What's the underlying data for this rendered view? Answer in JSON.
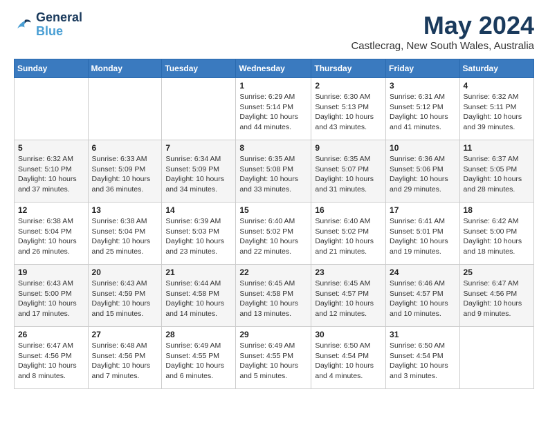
{
  "logo": {
    "line1": "General",
    "line2": "Blue"
  },
  "title": "May 2024",
  "subtitle": "Castlecrag, New South Wales, Australia",
  "days_header": [
    "Sunday",
    "Monday",
    "Tuesday",
    "Wednesday",
    "Thursday",
    "Friday",
    "Saturday"
  ],
  "weeks": [
    [
      {
        "day": "",
        "detail": ""
      },
      {
        "day": "",
        "detail": ""
      },
      {
        "day": "",
        "detail": ""
      },
      {
        "day": "1",
        "detail": "Sunrise: 6:29 AM\nSunset: 5:14 PM\nDaylight: 10 hours\nand 44 minutes."
      },
      {
        "day": "2",
        "detail": "Sunrise: 6:30 AM\nSunset: 5:13 PM\nDaylight: 10 hours\nand 43 minutes."
      },
      {
        "day": "3",
        "detail": "Sunrise: 6:31 AM\nSunset: 5:12 PM\nDaylight: 10 hours\nand 41 minutes."
      },
      {
        "day": "4",
        "detail": "Sunrise: 6:32 AM\nSunset: 5:11 PM\nDaylight: 10 hours\nand 39 minutes."
      }
    ],
    [
      {
        "day": "5",
        "detail": "Sunrise: 6:32 AM\nSunset: 5:10 PM\nDaylight: 10 hours\nand 37 minutes."
      },
      {
        "day": "6",
        "detail": "Sunrise: 6:33 AM\nSunset: 5:09 PM\nDaylight: 10 hours\nand 36 minutes."
      },
      {
        "day": "7",
        "detail": "Sunrise: 6:34 AM\nSunset: 5:09 PM\nDaylight: 10 hours\nand 34 minutes."
      },
      {
        "day": "8",
        "detail": "Sunrise: 6:35 AM\nSunset: 5:08 PM\nDaylight: 10 hours\nand 33 minutes."
      },
      {
        "day": "9",
        "detail": "Sunrise: 6:35 AM\nSunset: 5:07 PM\nDaylight: 10 hours\nand 31 minutes."
      },
      {
        "day": "10",
        "detail": "Sunrise: 6:36 AM\nSunset: 5:06 PM\nDaylight: 10 hours\nand 29 minutes."
      },
      {
        "day": "11",
        "detail": "Sunrise: 6:37 AM\nSunset: 5:05 PM\nDaylight: 10 hours\nand 28 minutes."
      }
    ],
    [
      {
        "day": "12",
        "detail": "Sunrise: 6:38 AM\nSunset: 5:04 PM\nDaylight: 10 hours\nand 26 minutes."
      },
      {
        "day": "13",
        "detail": "Sunrise: 6:38 AM\nSunset: 5:04 PM\nDaylight: 10 hours\nand 25 minutes."
      },
      {
        "day": "14",
        "detail": "Sunrise: 6:39 AM\nSunset: 5:03 PM\nDaylight: 10 hours\nand 23 minutes."
      },
      {
        "day": "15",
        "detail": "Sunrise: 6:40 AM\nSunset: 5:02 PM\nDaylight: 10 hours\nand 22 minutes."
      },
      {
        "day": "16",
        "detail": "Sunrise: 6:40 AM\nSunset: 5:02 PM\nDaylight: 10 hours\nand 21 minutes."
      },
      {
        "day": "17",
        "detail": "Sunrise: 6:41 AM\nSunset: 5:01 PM\nDaylight: 10 hours\nand 19 minutes."
      },
      {
        "day": "18",
        "detail": "Sunrise: 6:42 AM\nSunset: 5:00 PM\nDaylight: 10 hours\nand 18 minutes."
      }
    ],
    [
      {
        "day": "19",
        "detail": "Sunrise: 6:43 AM\nSunset: 5:00 PM\nDaylight: 10 hours\nand 17 minutes."
      },
      {
        "day": "20",
        "detail": "Sunrise: 6:43 AM\nSunset: 4:59 PM\nDaylight: 10 hours\nand 15 minutes."
      },
      {
        "day": "21",
        "detail": "Sunrise: 6:44 AM\nSunset: 4:58 PM\nDaylight: 10 hours\nand 14 minutes."
      },
      {
        "day": "22",
        "detail": "Sunrise: 6:45 AM\nSunset: 4:58 PM\nDaylight: 10 hours\nand 13 minutes."
      },
      {
        "day": "23",
        "detail": "Sunrise: 6:45 AM\nSunset: 4:57 PM\nDaylight: 10 hours\nand 12 minutes."
      },
      {
        "day": "24",
        "detail": "Sunrise: 6:46 AM\nSunset: 4:57 PM\nDaylight: 10 hours\nand 10 minutes."
      },
      {
        "day": "25",
        "detail": "Sunrise: 6:47 AM\nSunset: 4:56 PM\nDaylight: 10 hours\nand 9 minutes."
      }
    ],
    [
      {
        "day": "26",
        "detail": "Sunrise: 6:47 AM\nSunset: 4:56 PM\nDaylight: 10 hours\nand 8 minutes."
      },
      {
        "day": "27",
        "detail": "Sunrise: 6:48 AM\nSunset: 4:56 PM\nDaylight: 10 hours\nand 7 minutes."
      },
      {
        "day": "28",
        "detail": "Sunrise: 6:49 AM\nSunset: 4:55 PM\nDaylight: 10 hours\nand 6 minutes."
      },
      {
        "day": "29",
        "detail": "Sunrise: 6:49 AM\nSunset: 4:55 PM\nDaylight: 10 hours\nand 5 minutes."
      },
      {
        "day": "30",
        "detail": "Sunrise: 6:50 AM\nSunset: 4:54 PM\nDaylight: 10 hours\nand 4 minutes."
      },
      {
        "day": "31",
        "detail": "Sunrise: 6:50 AM\nSunset: 4:54 PM\nDaylight: 10 hours\nand 3 minutes."
      },
      {
        "day": "",
        "detail": ""
      }
    ]
  ]
}
